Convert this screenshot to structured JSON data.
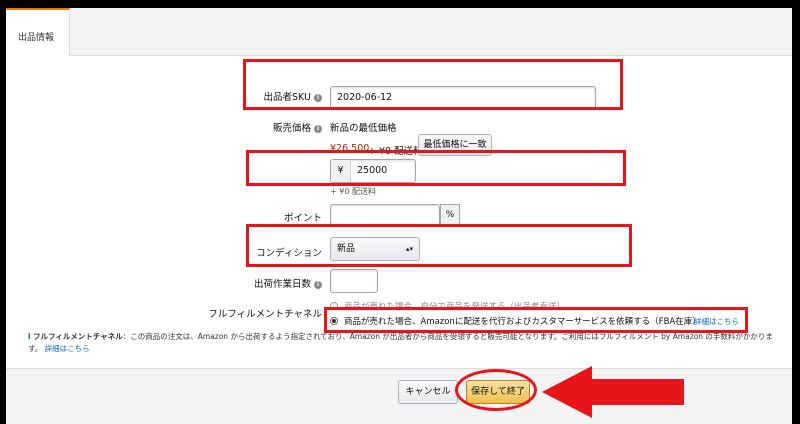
{
  "tab": {
    "label": "出品情報"
  },
  "sku": {
    "label": "出品者SKU",
    "value": "2020-06-12"
  },
  "price": {
    "label": "販売価格",
    "lowest_heading": "新品の最低価格",
    "lowest_value": "¥26,500",
    "lowest_shipping": "+ ¥0 配送料",
    "match_button": "最低価格に一致",
    "currency": "¥",
    "value": "25000",
    "shipping_note": "+ ¥0 配送料"
  },
  "point": {
    "label": "ポイント",
    "unit": "%"
  },
  "condition": {
    "label": "コンディション",
    "value": "新品"
  },
  "handling": {
    "label": "出荷作業日数"
  },
  "fulfillment": {
    "label": "フルフィルメントチャネル",
    "option_merchant": "商品が売れた場合、自分で商品を発送する（出品者直送）",
    "option_fba": "商品が売れた場合、Amazonに配送を代行およびカスタマーサービスを依頼する（FBA在庫）",
    "details_link": "詳細はこちら"
  },
  "note": {
    "title": "フルフィルメントチャネル",
    "text": "：この商品の注文は、Amazon から出荷するよう指定されており、Amazon が出品者から商品を受領すると販売可能となります。ご利用にはフルフィルメント by Amazon の手数料がかかります。",
    "link": "詳細はこちら"
  },
  "actions": {
    "cancel": "キャンセル",
    "save": "保存して終了"
  },
  "colors": {
    "annotation": "#e8141a",
    "primary_button": "#f0c14b",
    "accent": "#e47911"
  }
}
